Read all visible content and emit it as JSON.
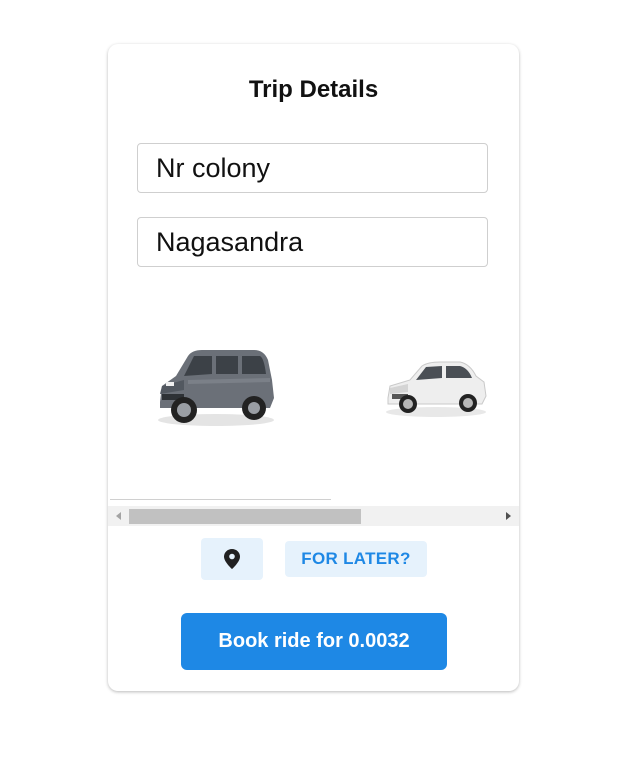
{
  "trip": {
    "title": "Trip Details",
    "pickup_value": "Nr colony",
    "drop_value": "Nagasandra"
  },
  "vehicles": [
    {
      "name": "suv-image",
      "color": "#6b7078"
    },
    {
      "name": "sedan-image",
      "color": "#e8e8e8"
    }
  ],
  "actions": {
    "location_icon": "location-pin-icon",
    "later_label": "FOR LATER?",
    "book_label": "Book ride for 0.0032"
  },
  "colors": {
    "accent": "#1e88e5",
    "accent_light": "#e6f2fc"
  }
}
